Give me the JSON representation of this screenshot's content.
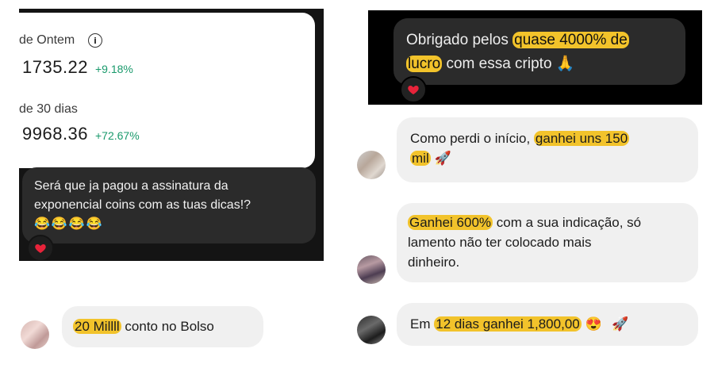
{
  "screenshot1": {
    "card": {
      "yesterday_label": "de Ontem",
      "yesterday_value": "1735.22",
      "yesterday_change": "+9.18%",
      "thirty_days_label": "de 30 dias",
      "thirty_days_value": "9968.36",
      "thirty_days_change": "+72.67%"
    },
    "message": {
      "line1": "Será que ja pagou a assinatura da",
      "line2": "exponencial coins com as tuas dicas!?",
      "emojis": "😂😂😂😂",
      "reaction": "heart-icon"
    }
  },
  "screenshot2": {
    "message": {
      "part1": "Obrigado pelos ",
      "highlight1": "quase 4000% de",
      "highlight2": "lucro",
      "part2": " com essa cripto",
      "emoji": "🙏",
      "reaction": "heart-icon"
    }
  },
  "comments": [
    {
      "pre": "Como perdi o início, ",
      "highlight_a": "ganhei uns 150",
      "highlight_b": "mil",
      "post": " 🚀"
    },
    {
      "highlight": "Ganhei 600%",
      "post_line1": " com a sua indicação, só",
      "line2": "lamento não ter colocado mais",
      "line3": "dinheiro."
    },
    {
      "pre": "Em ",
      "highlight": "12 dias ganhei 1,800,00",
      "emoji1": "😍",
      "emoji2": "🚀"
    },
    {
      "highlight": "20 Millll",
      "post": " conto no Bolso"
    }
  ],
  "colors": {
    "highlight": "#f2c32b",
    "positive": "#1a9a6c",
    "heart": "#e8233a"
  }
}
